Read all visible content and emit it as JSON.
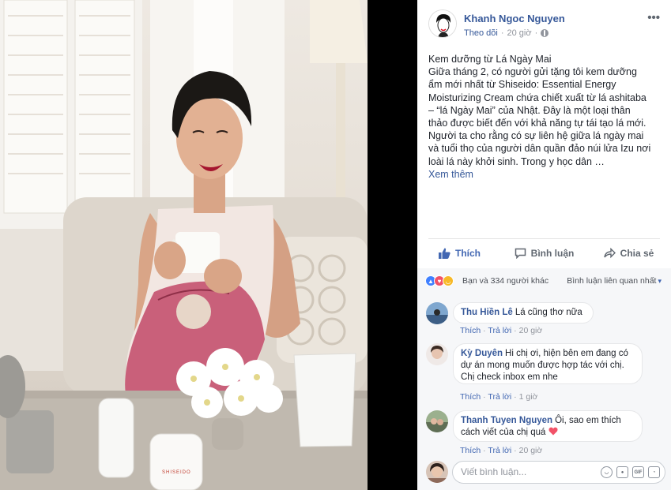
{
  "post": {
    "author": "Khanh Ngoc Nguyen",
    "follow_label": "Theo dõi",
    "separator": "·",
    "time": "20 giờ",
    "more": "•••",
    "text_lines": [
      "Kem dưỡng từ Lá Ngày Mai",
      "Giữa tháng 2, có người gửi tặng tôi kem dưỡng",
      "ẩm mới nhất từ Shiseido: Essential Energy",
      "Moisturizing Cream chứa chiết xuất từ lá ashitaba",
      "– “lá Ngày Mai” của Nhật. Đây là một loại thân",
      "thảo được biết đến với khả năng tự tái tạo lá mới.",
      "Người ta cho rằng có sự liên hệ giữa lá ngày mai",
      "và tuổi thọ của người dân quần đảo núi lửa Izu nơi",
      "loài lá này khởi sinh. Trong y học dân …"
    ],
    "see_more": "Xem thêm"
  },
  "actions": {
    "like": "Thích",
    "comment": "Bình luận",
    "share": "Chia sẻ"
  },
  "reactions": {
    "summary": "Bạn và 334 người khác",
    "sort_label": "Bình luận liên quan nhất",
    "sort_caret": "▾"
  },
  "comments": [
    {
      "name": "Thu Hiền Lê",
      "text": "Lá cũng thơ nữa",
      "like": "Thích",
      "reply": "Trả lời",
      "time": "20 giờ"
    },
    {
      "name": "Kỳ Duyên",
      "text_lines": [
        "Hi chị ơi, hiện bên em đang có",
        "dự án mong muốn được hợp tác với chị.",
        "Chị check inbox em nhe"
      ],
      "like": "Thích",
      "reply": "Trả lời",
      "time": "1 giờ"
    },
    {
      "name": "Thanh Tuyen Nguyen",
      "text_lines": [
        "Ôi, sao em thích",
        "cách viết của chị quá"
      ],
      "like": "Thích",
      "reply": "Trả lời",
      "time": "20 giờ"
    }
  ],
  "composer": {
    "placeholder": "Viết bình luận...",
    "gif": "GIF"
  },
  "photo": {
    "cream_brand": "SHISEIDO"
  },
  "colors": {
    "link": "#365899",
    "like_blue": "#4267b2",
    "muted": "#90949c",
    "panel_bg": "#f6f7f9"
  }
}
